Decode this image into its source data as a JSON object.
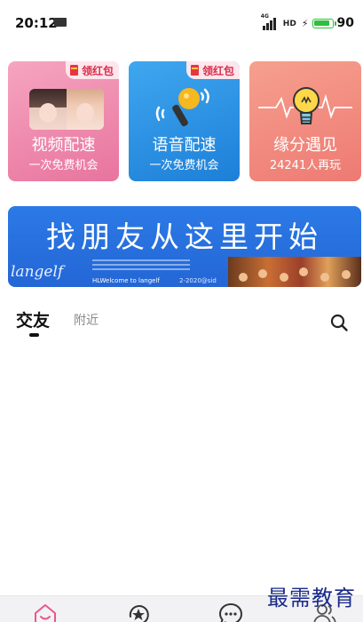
{
  "status_bar": {
    "time": "20:12",
    "network": "4G",
    "hd": "HD",
    "battery_level": 90,
    "battery_text": "90"
  },
  "cards": [
    {
      "badge": "领红包",
      "title": "视频配速",
      "subtitle": "一次免费机会",
      "icon": "video-avatars"
    },
    {
      "badge": "领红包",
      "title": "语音配速",
      "subtitle": "一次免费机会",
      "icon": "microphone-icon"
    },
    {
      "title": "缘分遇见",
      "subtitle": "24241人再玩",
      "icon": "lightbulb-icon"
    }
  ],
  "banner": {
    "title": "找朋友从这里开始",
    "logo": "langelf",
    "welcome": "HLWelcome to langelf",
    "copyright": "2-2020@sid"
  },
  "tabs": {
    "active": "交友",
    "nearby": "附近"
  },
  "bottom_nav": [
    {
      "icon": "home-icon"
    },
    {
      "icon": "star-refresh-icon"
    },
    {
      "icon": "message-icon"
    },
    {
      "icon": "contacts-icon"
    }
  ],
  "watermark": "最需教育",
  "colors": {
    "card_pink": "#e8749d",
    "card_blue": "#1d7fd8",
    "card_coral": "#ee7a73",
    "banner_blue": "#2466d6",
    "badge_red": "#d92d4b",
    "battery_green": "#2fbf3b",
    "watermark_blue": "#1a2b8a"
  }
}
